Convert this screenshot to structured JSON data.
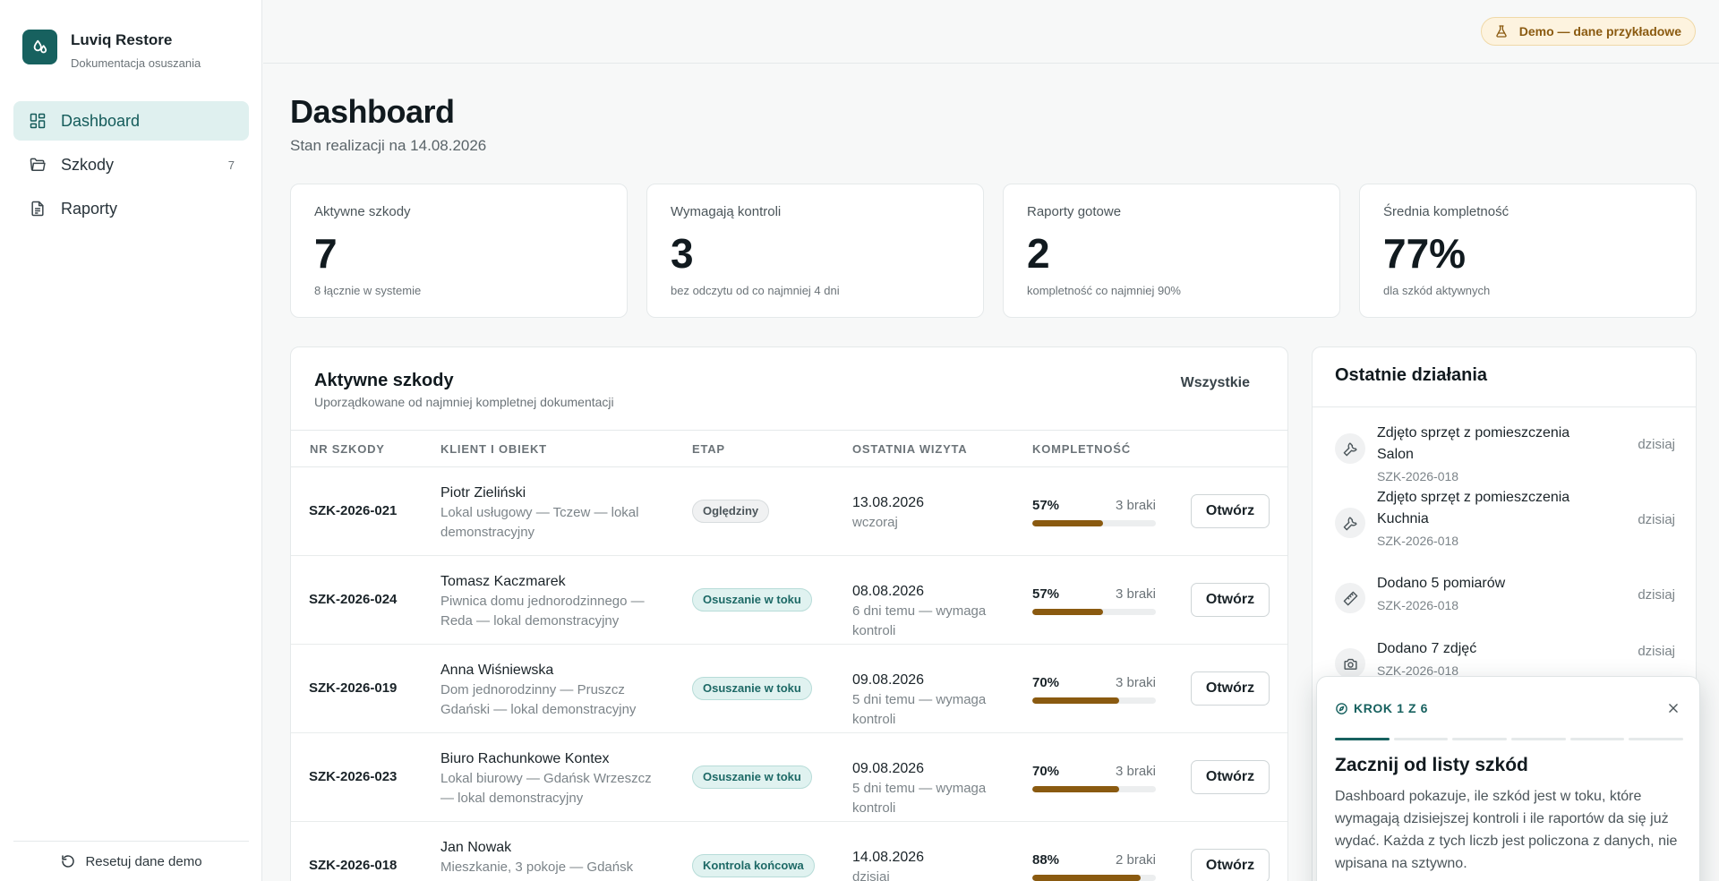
{
  "app": {
    "name": "Luviq Restore",
    "subtitle": "Dokumentacja osuszania",
    "brand_color": "#17615f"
  },
  "sidebar": {
    "items": [
      {
        "label": "Dashboard",
        "icon": "dashboard-icon",
        "active": true
      },
      {
        "label": "Szkody",
        "icon": "folder-icon",
        "count": "7"
      },
      {
        "label": "Raporty",
        "icon": "document-icon"
      }
    ],
    "reset_label": "Resetuj dane demo"
  },
  "topbar": {
    "demo_badge": "Demo — dane przykładowe"
  },
  "header": {
    "title": "Dashboard",
    "subtitle": "Stan realizacji na 14.08.2026"
  },
  "stats": [
    {
      "label": "Aktywne szkody",
      "value": "7",
      "note": "8 łącznie w systemie"
    },
    {
      "label": "Wymagają kontroli",
      "value": "3",
      "note": "bez odczytu od co najmniej 4 dni"
    },
    {
      "label": "Raporty gotowe",
      "value": "2",
      "note": "kompletność co najmniej 90%"
    },
    {
      "label": "Średnia kompletność",
      "value": "77%",
      "note": "dla szkód aktywnych"
    }
  ],
  "table": {
    "title": "Aktywne szkody",
    "subtitle": "Uporządkowane od najmniej kompletnej dokumentacji",
    "all_link": "Wszystkie",
    "columns": [
      "NR SZKODY",
      "KLIENT I OBIEKT",
      "ETAP",
      "OSTATNIA WIZYTA",
      "KOMPLETNOŚĆ"
    ],
    "open_label": "Otwórz",
    "rows": [
      {
        "nr": "SZK-2026-021",
        "client": "Piotr Zieliński",
        "object": "Lokal usługowy — Tczew — lokal demonstracyjny",
        "stage": "Oględziny",
        "stage_style": "grey",
        "date": "13.08.2026",
        "relative": "wczoraj",
        "pct": "57%",
        "fraction": 0.57,
        "missing": "3 braki"
      },
      {
        "nr": "SZK-2026-024",
        "client": "Tomasz Kaczmarek",
        "object": "Piwnica domu jednorodzinnego — Reda — lokal demonstracyjny",
        "stage": "Osuszanie w toku",
        "stage_style": "teal",
        "date": "08.08.2026",
        "relative": "6 dni temu — wymaga kontroli",
        "pct": "57%",
        "fraction": 0.57,
        "missing": "3 braki"
      },
      {
        "nr": "SZK-2026-019",
        "client": "Anna Wiśniewska",
        "object": "Dom jednorodzinny — Pruszcz Gdański — lokal demonstracyjny",
        "stage": "Osuszanie w toku",
        "stage_style": "teal",
        "date": "09.08.2026",
        "relative": "5 dni temu — wymaga kontroli",
        "pct": "70%",
        "fraction": 0.7,
        "missing": "3 braki"
      },
      {
        "nr": "SZK-2026-023",
        "client": "Biuro Rachunkowe Kontex",
        "object": "Lokal biurowy — Gdańsk Wrzeszcz — lokal demonstracyjny",
        "stage": "Osuszanie w toku",
        "stage_style": "teal",
        "date": "09.08.2026",
        "relative": "5 dni temu — wymaga kontroli",
        "pct": "70%",
        "fraction": 0.7,
        "missing": "3 braki"
      },
      {
        "nr": "SZK-2026-018",
        "client": "Jan Nowak",
        "object": "Mieszkanie, 3 pokoje — Gdańsk",
        "stage": "Kontrola końcowa",
        "stage_style": "teal",
        "date": "14.08.2026",
        "relative": "dzisiaj",
        "pct": "88%",
        "fraction": 0.88,
        "missing": "2 braki"
      }
    ]
  },
  "activity": {
    "title": "Ostatnie działania",
    "items": [
      {
        "text": "Zdjęto sprzęt z pomieszczenia Salon",
        "id": "SZK-2026-018",
        "when": "dzisiaj",
        "icon": "wrench-icon"
      },
      {
        "text": "Zdjęto sprzęt z pomieszczenia Kuchnia",
        "id": "SZK-2026-018",
        "when": "dzisiaj",
        "icon": "wrench-icon"
      },
      {
        "text": "Dodano 5 pomiarów",
        "id": "SZK-2026-018",
        "when": "dzisiaj",
        "icon": "ruler-icon"
      },
      {
        "text": "Dodano 7 zdjęć",
        "id": "SZK-2026-018",
        "when": "dzisiaj",
        "icon": "camera-icon"
      }
    ]
  },
  "tour": {
    "step": "KROK 1 Z 6",
    "current_step": 1,
    "total_steps": 6,
    "title": "Zacznij od listy szkód",
    "body": "Dashboard pokazuje, ile szkód jest w toku, które wymagają dzisiejszej kontroli i ile raportów da się już wydać. Każda z tych liczb jest policzona z danych, nie wpisana na sztywno."
  }
}
